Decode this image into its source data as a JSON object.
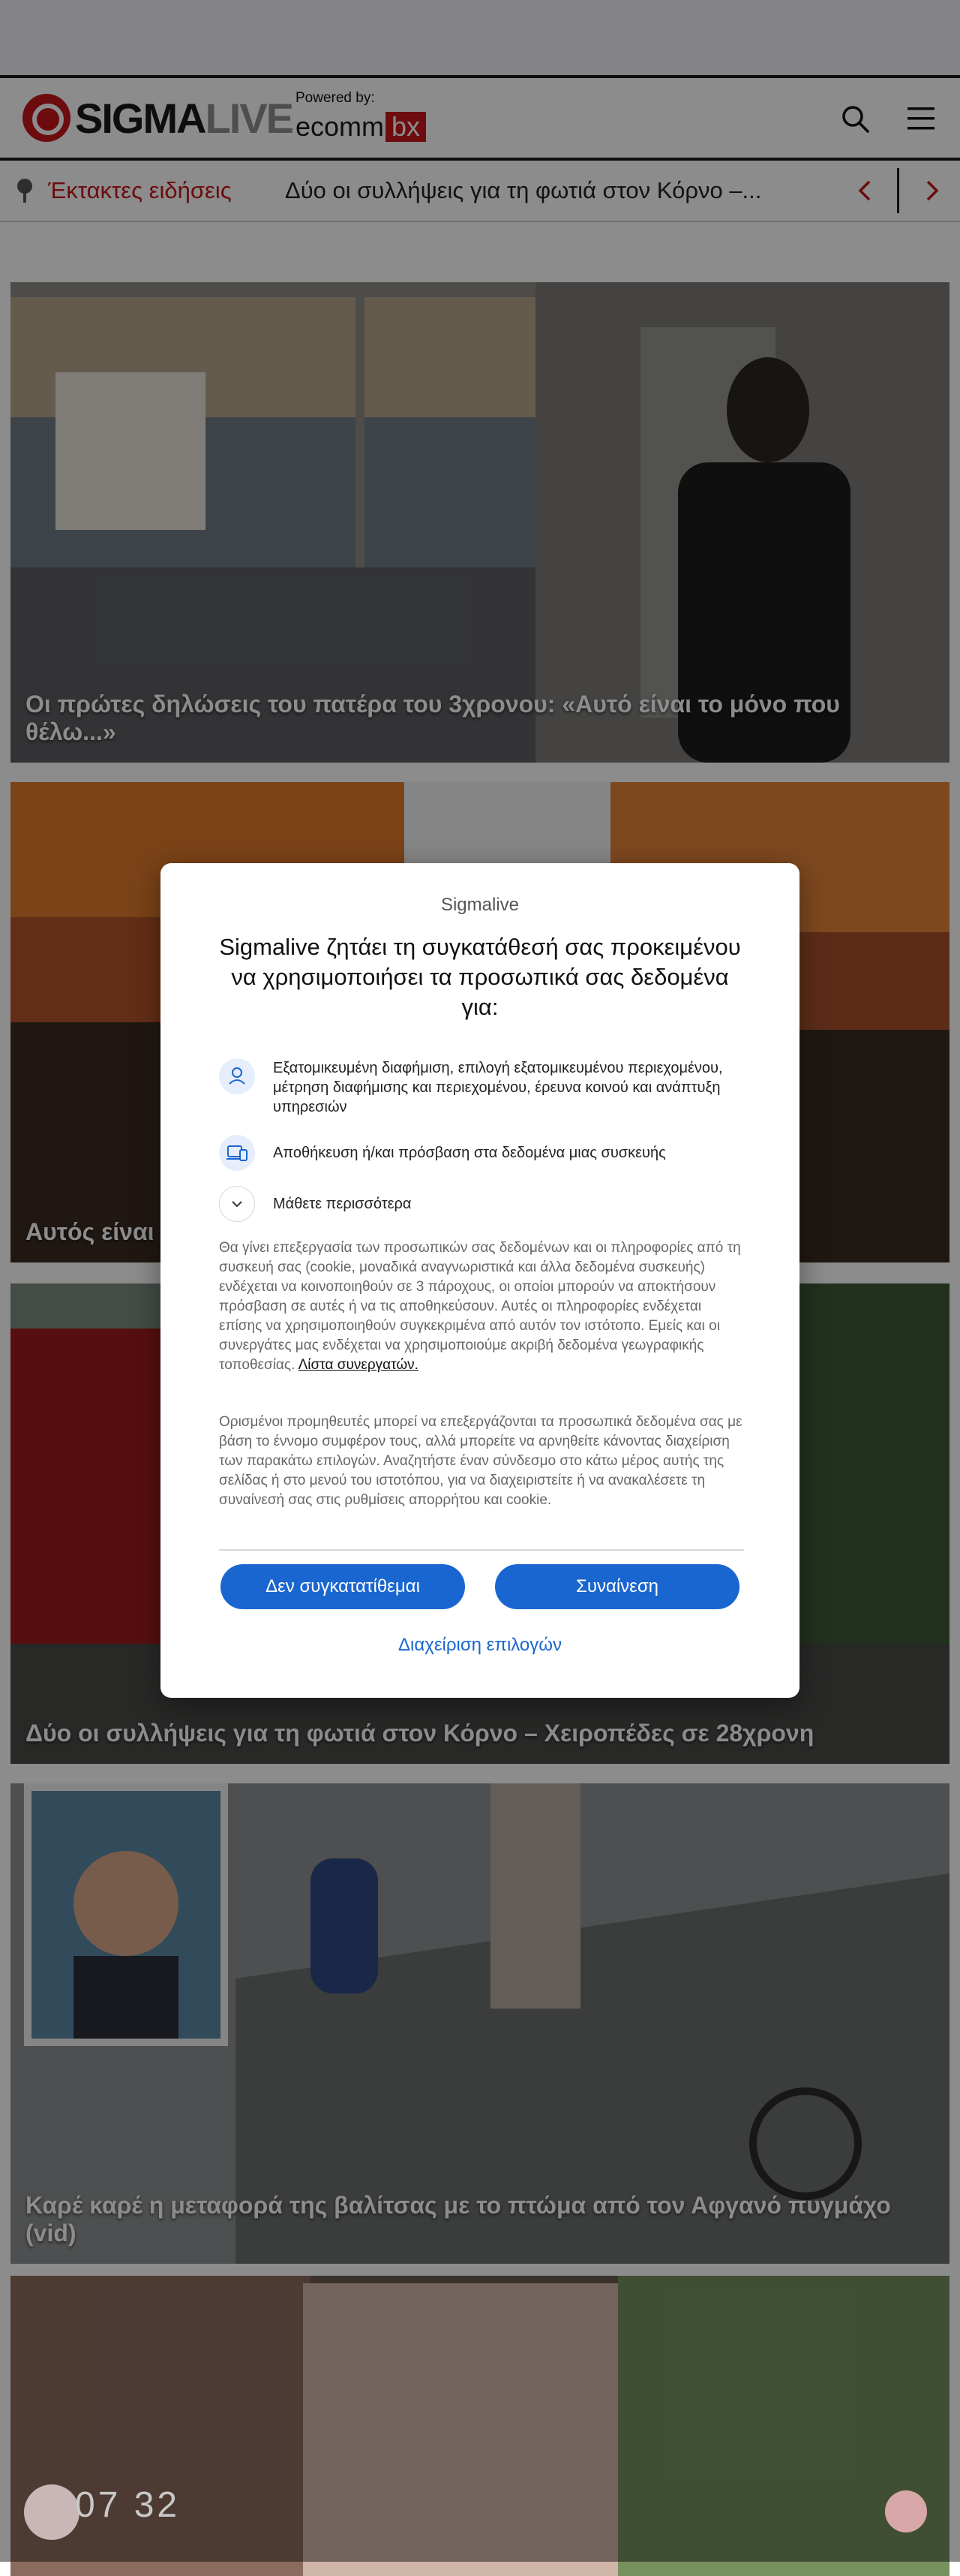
{
  "header": {
    "logo_main": "SIGMA",
    "logo_accent": "LIVE",
    "powered_label": "Powered by:",
    "powered_brand": "ecomm",
    "powered_brand_accent": "bx"
  },
  "ticker": {
    "label": "Έκτακτες ειδήσεις",
    "headline": "Δύο οι συλλήψεις για τη φωτιά στον Κόρνο –..."
  },
  "articles": [
    {
      "title": "Οι πρώτες δηλώσεις του πατέρα του 3χρονου: «Αυτό είναι το μόνο που θέλω...»"
    },
    {
      "title": "Αυτός είναι ο"
    },
    {
      "title": "Δύο οι συλλήψεις για τη φωτιά στον Κόρνο – Χειροπέδες σε 28χρονη"
    },
    {
      "title": "Καρέ καρέ η μεταφορά της βαλίτσας με το πτώμα από τον Αφγανό πυγμάχο (vid)"
    }
  ],
  "consent": {
    "site": "Sigmalive",
    "title": "Sigmalive ζητάει τη συγκατάθεσή σας προκειμένου να χρησιμοποιήσει τα προσωπικά σας δεδομένα για:",
    "purposes": [
      "Εξατομικευμένη διαφήμιση, επιλογή εξατομικευμένου περιεχομένου, μέτρηση διαφήμισης και περιεχομένου, έρευνα κοινού και ανάπτυξη υπηρεσιών",
      "Αποθήκευση ή/και πρόσβαση στα δεδομένα μιας συσκευής"
    ],
    "learn_more": "Μάθετε περισσότερα",
    "body1": "Θα γίνει επεξεργασία των προσωπικών σας δεδομένων και οι πληροφορίες από τη συσκευή σας (cookie, μοναδικά αναγνωριστικά και άλλα δεδομένα συσκευής) ενδέχεται να κοινοποιηθούν σε 3 πάροχους, οι οποίοι μπορούν να αποκτήσουν πρόσβαση σε αυτές ή να τις αποθηκεύσουν. Αυτές οι πληροφορίες ενδέχεται επίσης να χρησιμοποιηθούν συγκεκριμένα από αυτόν τον ιστότοπο. Εμείς και οι συνεργάτες μας ενδέχεται να χρησιμοποιούμε ακριβή δεδομένα γεωγραφικής τοποθεσίας.",
    "partners_link": "Λίστα συνεργατών.",
    "body2": "Ορισμένοι προμηθευτές μπορεί να επεξεργάζονται τα προσωπικά δεδομένα σας με βάση το έννομο συμφέρον τους, αλλά μπορείτε να αρνηθείτε κάνοντας διαχείριση των παρακάτω επιλογών. Αναζητήστε έναν σύνδεσμο στο κάτω μέρος αυτής της σελίδας ή στο μενού του ιστοτόπου, για να διαχειριστείτε ή να ανακαλέσετε τη συναίνεσή σας στις ρυθμίσεις απορρήτου και cookie.",
    "decline": "Δεν συγκατατίθεμαι",
    "accept": "Συναίνεση",
    "manage": "Διαχείριση επιλογών"
  },
  "footer_widget": {
    "digits": "07 32"
  }
}
